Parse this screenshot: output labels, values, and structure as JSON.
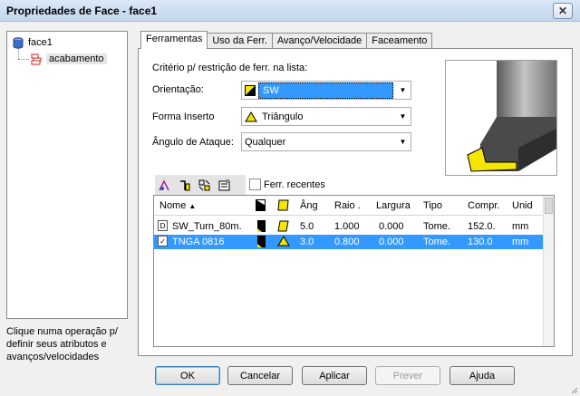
{
  "window": {
    "title": "Propriedades de Face - face1",
    "close_glyph": "✕"
  },
  "tree": {
    "root": "face1",
    "child": "acabamento"
  },
  "hint": "Clique numa operação p/ definir seus atributos e avanços/velocidades",
  "tabs": [
    "Ferramentas",
    "Uso da Ferr.",
    "Avanço/Velocidade",
    "Faceamento"
  ],
  "criteria_label": "Critério p/ restrição de ferr. na lista:",
  "fields": {
    "orientation": {
      "label": "Orientação:",
      "value": "SW"
    },
    "insert_shape": {
      "label": "Forma Inserto",
      "value": "Triângulo"
    },
    "attack_angle": {
      "label": "Ângulo de Ataque:",
      "value": "Qualquer"
    }
  },
  "recent_label": "Ferr. recentes",
  "table": {
    "columns": [
      "Nome",
      "",
      "",
      "Âng",
      "Raio .",
      "Largura",
      "Tipo",
      "Compr.",
      "Unid"
    ],
    "rows": [
      {
        "marker": "D",
        "name": "SW_Turn_80m.",
        "ang": "5.0",
        "raio": "1.000",
        "largura": "0.000",
        "tipo": "Tome.",
        "compr": "152.0.",
        "unid": "mm",
        "selected": false
      },
      {
        "marker": "✓",
        "name": "TNGA 0816",
        "ang": "3.0",
        "raio": "0.800",
        "largura": "0.000",
        "tipo": "Tome.",
        "compr": "130.0",
        "unid": "mm",
        "selected": true
      }
    ]
  },
  "buttons": {
    "ok": "OK",
    "cancel": "Cancelar",
    "apply": "Aplicar",
    "preview": "Prever",
    "help": "Ajuda"
  },
  "colors": {
    "selection": "#3399ff",
    "insert_yellow": "#f5e600"
  },
  "icons": {
    "tree_root": "cylinder-icon",
    "tree_child": "finishing-op-icon",
    "toolbar": [
      "tool-new-icon",
      "tool-edit-icon",
      "tool-library-icon",
      "tool-properties-icon"
    ]
  }
}
